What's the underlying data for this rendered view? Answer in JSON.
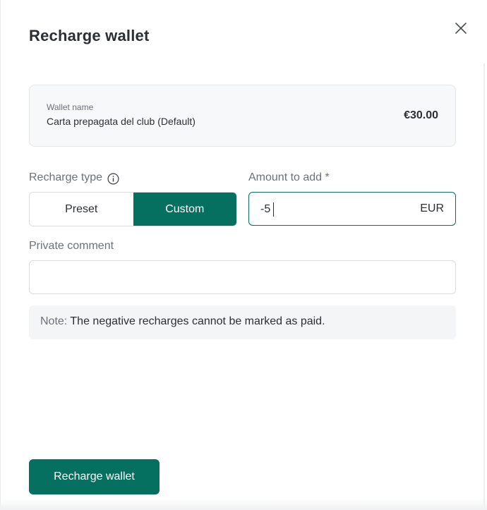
{
  "modal": {
    "title": "Recharge wallet",
    "close_icon": "close-icon"
  },
  "wallet": {
    "label": "Wallet name",
    "name": "Carta prepagata del club (Default)",
    "balance": "€30.00"
  },
  "recharge_type": {
    "label": "Recharge type",
    "info_icon": "info-icon",
    "options": [
      "Preset",
      "Custom"
    ],
    "selected": "Custom"
  },
  "amount": {
    "label": "Amount to add *",
    "value": "-5",
    "currency": "EUR"
  },
  "comment": {
    "label": "Private comment",
    "value": ""
  },
  "note": {
    "prefix": "Note:",
    "text": " The negative recharges cannot be marked as paid."
  },
  "actions": {
    "submit_label": "Recharge wallet"
  },
  "colors": {
    "accent": "#05705f",
    "text": "#2b2f33",
    "muted": "#6b7178"
  }
}
